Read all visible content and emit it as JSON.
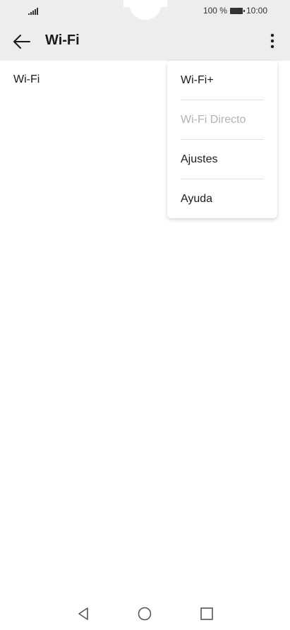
{
  "status_bar": {
    "battery_percent": "100 %",
    "time": "10:00"
  },
  "app_bar": {
    "title": "Wi-Fi",
    "back_icon": "arrow-left-icon",
    "more_icon": "more-vertical-icon"
  },
  "main": {
    "wifi_label": "Wi-Fi"
  },
  "menu": {
    "items": [
      {
        "label": "Wi-Fi+",
        "enabled": true
      },
      {
        "label": "Wi-Fi Directo",
        "enabled": false
      },
      {
        "label": "Ajustes",
        "enabled": true
      },
      {
        "label": "Ayuda",
        "enabled": true
      }
    ]
  },
  "nav_bar": {
    "back_icon": "triangle-back-icon",
    "home_icon": "circle-home-icon",
    "recent_icon": "square-recents-icon"
  },
  "colors": {
    "top_background": "#ededed",
    "disabled_text": "#b3b3b3"
  }
}
